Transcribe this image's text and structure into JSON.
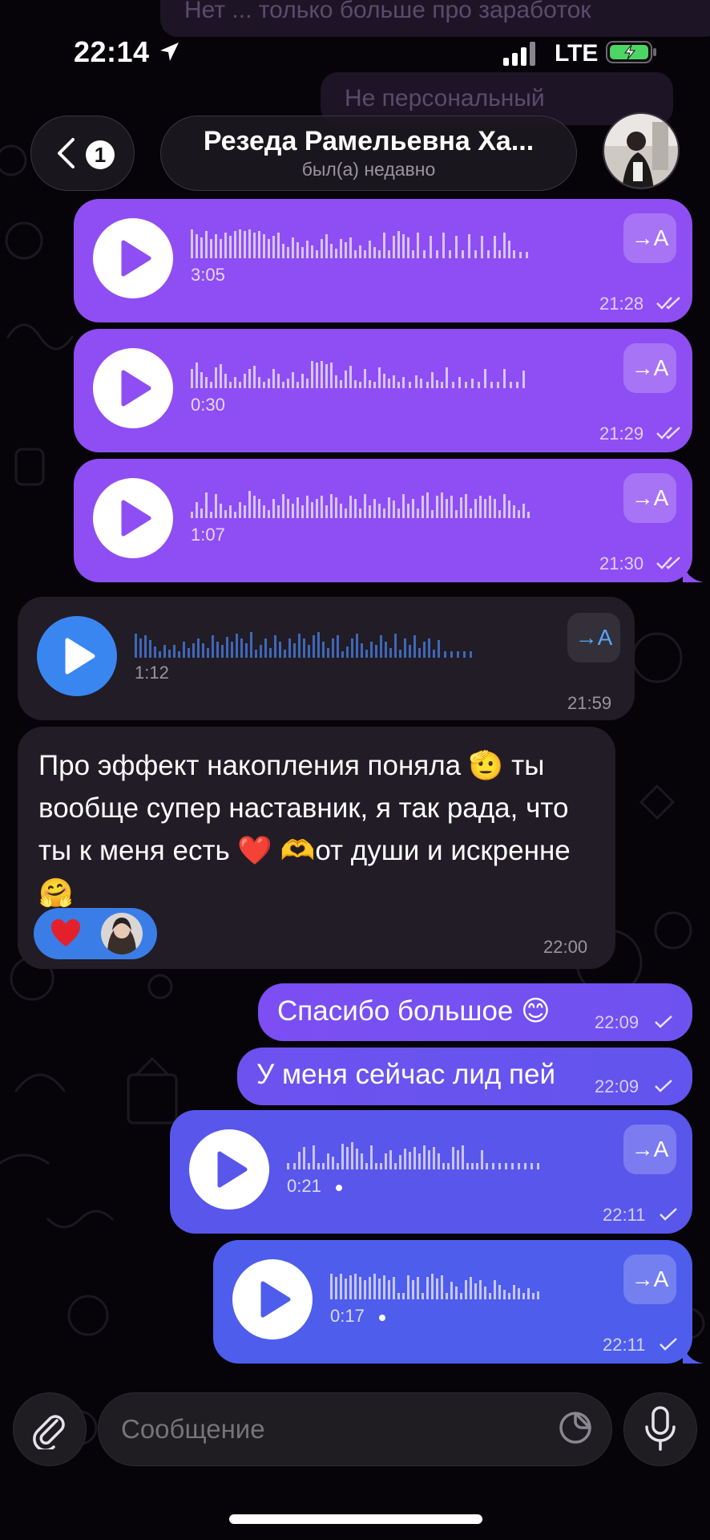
{
  "status_bar": {
    "time": "22:14",
    "network": "LTE"
  },
  "background_messages": [
    "Нет ... только больше про заработок",
    "Не персональный"
  ],
  "header": {
    "unread_count": "1",
    "title": "Резеда Рамельевна Ха...",
    "subtitle": "был(а) недавно"
  },
  "messages": [
    {
      "type": "voice",
      "direction": "out",
      "duration": "3:05",
      "time": "21:28",
      "transcribe_label": "→A"
    },
    {
      "type": "voice",
      "direction": "out",
      "duration": "0:30",
      "time": "21:29",
      "transcribe_label": "→A"
    },
    {
      "type": "voice",
      "direction": "out",
      "duration": "1:07",
      "time": "21:30",
      "transcribe_label": "→A"
    },
    {
      "type": "voice",
      "direction": "in",
      "duration": "1:12",
      "time": "21:59",
      "transcribe_label": "→A"
    },
    {
      "type": "text",
      "direction": "in",
      "text": "Про эффект накопления поняла 🫡 ты вообще супер наставник, я так рада, что ты к меня есть ❤️ 🫶от души и искренне 🤗",
      "time": "22:00",
      "reaction": "heart"
    },
    {
      "type": "text",
      "direction": "out",
      "text": "Спасибо большое 😊",
      "time": "22:09"
    },
    {
      "type": "text",
      "direction": "out",
      "text": "У меня сейчас лид пей",
      "time": "22:09"
    },
    {
      "type": "voice",
      "direction": "out",
      "duration": "0:21",
      "time": "22:11",
      "transcribe_label": "→A"
    },
    {
      "type": "voice",
      "direction": "out",
      "duration": "0:17",
      "time": "22:11",
      "transcribe_label": "→A"
    }
  ],
  "input": {
    "placeholder": "Сообщение"
  },
  "colors": {
    "outgoing_purple": "#8f4ef3",
    "outgoing_blue": "#5556ec",
    "incoming": "#211c26",
    "accent_blue": "#3a86f0"
  },
  "icons": [
    "location-arrow-icon",
    "signal-icon",
    "battery-charging-icon",
    "back-chevron-icon",
    "play-icon",
    "transcribe-icon",
    "double-check-icon",
    "check-icon",
    "heart-icon",
    "paperclip-icon",
    "sticker-icon",
    "microphone-icon"
  ]
}
